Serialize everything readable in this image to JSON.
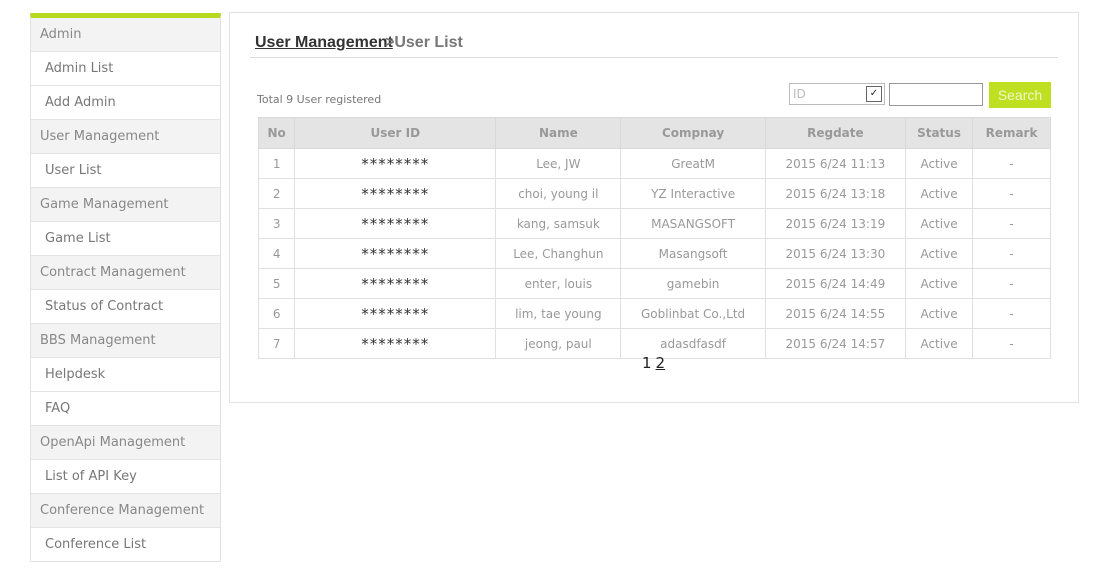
{
  "sidebar": {
    "groups": [
      {
        "label": "Admin",
        "items": [
          "Admin List",
          "Add Admin"
        ]
      },
      {
        "label": "User Management",
        "items": [
          "User List"
        ]
      },
      {
        "label": "Game Management",
        "items": [
          "Game List"
        ]
      },
      {
        "label": "Contract Management",
        "items": [
          "Status of Contract"
        ]
      },
      {
        "label": "BBS Management",
        "items": [
          "Helpdesk",
          "FAQ"
        ]
      },
      {
        "label": "OpenApi Management",
        "items": [
          "List of API Key"
        ]
      },
      {
        "label": "Conference Management",
        "items": [
          "Conference List"
        ]
      }
    ],
    "accent_color": "#b6d91f"
  },
  "breadcrumb": {
    "parent": "User Management ",
    "current": ">User List"
  },
  "summary": "Total 9 User registered",
  "search": {
    "field_selected": "ID",
    "query": "",
    "button_label": "Search",
    "button_color": "#bfe021"
  },
  "table": {
    "headers": [
      "No",
      "User ID",
      "Name",
      "Compnay",
      "Regdate",
      "Status",
      "Remark"
    ],
    "rows": [
      [
        "1",
        "********",
        "Lee, JW",
        "GreatM",
        "2015 6/24 11:13",
        "Active",
        "-"
      ],
      [
        "2",
        "********",
        "choi, young il",
        "YZ Interactive",
        "2015 6/24 13:18",
        "Active",
        "-"
      ],
      [
        "3",
        "********",
        "kang, samsuk",
        "MASANGSOFT",
        "2015 6/24 13:19",
        "Active",
        "-"
      ],
      [
        "4",
        "********",
        "Lee, Changhun",
        "Masangsoft",
        "2015 6/24 13:30",
        "Active",
        "-"
      ],
      [
        "5",
        "********",
        "enter, louis",
        "gamebin",
        "2015 6/24 14:49",
        "Active",
        "-"
      ],
      [
        "6",
        "********",
        "lim, tae young",
        "Goblinbat Co.,Ltd",
        "2015 6/24 14:55",
        "Active",
        "-"
      ],
      [
        "7",
        "********",
        "jeong, paul",
        "adasdfasdf",
        "2015 6/24 14:57",
        "Active",
        "-"
      ]
    ]
  },
  "pagination": {
    "pages": [
      "1",
      "2"
    ],
    "current": "1"
  }
}
